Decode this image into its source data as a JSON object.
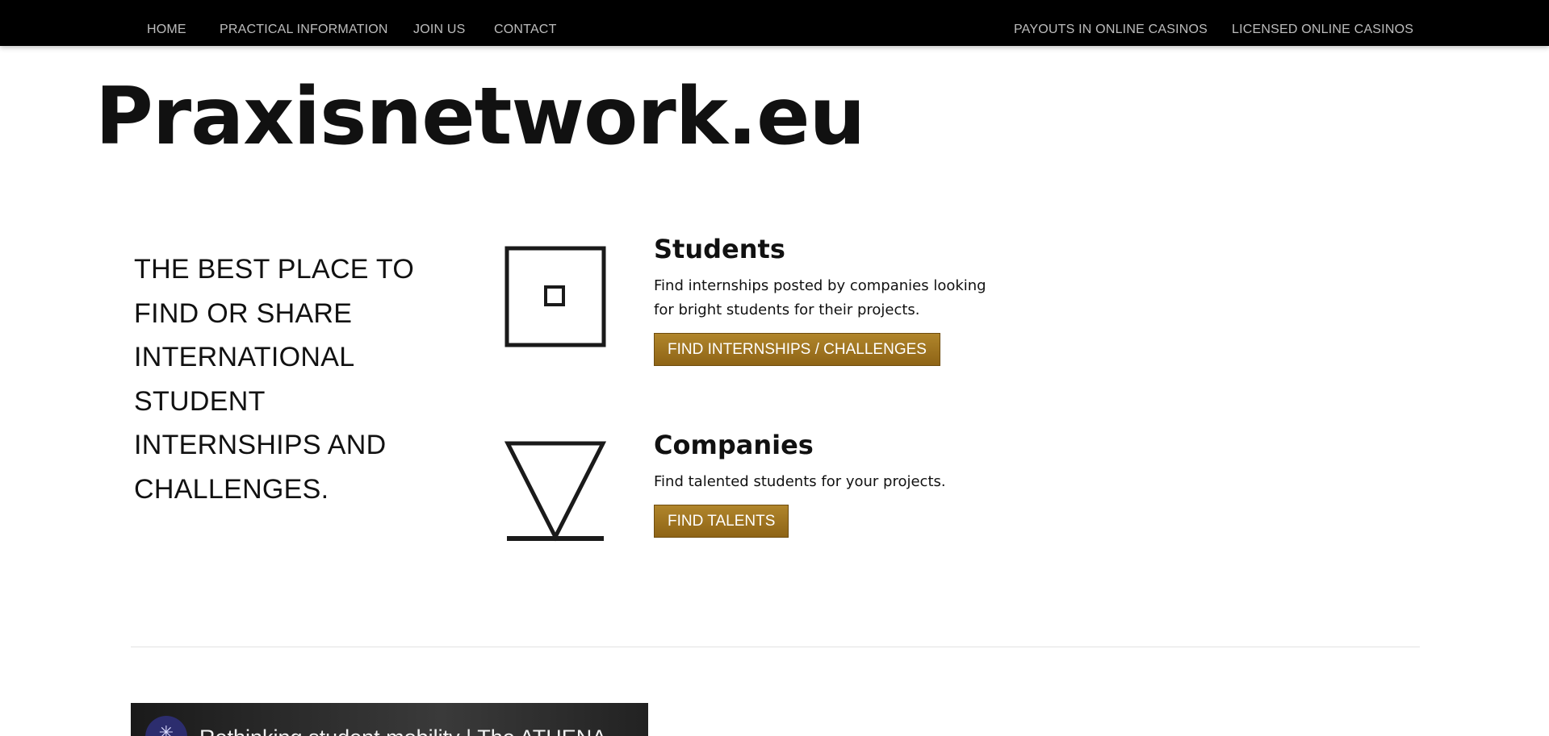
{
  "nav": {
    "left": [
      "HOME",
      "PRACTICAL INFORMATION",
      "JOIN US",
      "CONTACT"
    ],
    "right": [
      "PAYOUTS IN ONLINE CASINOS",
      "LICENSED ONLINE CASINOS"
    ]
  },
  "site_title": "Praxisnetwork.eu",
  "tagline": "THE BEST PLACE TO FIND OR SHARE INTERNATIONAL STUDENT INTERNSHIPS AND CHALLENGES.",
  "students": {
    "icon": "square-in-square-icon",
    "title": "Students",
    "desc": "Find internships posted by companies looking for bright students for their projects.",
    "button": "FIND INTERNSHIPS / CHALLENGES"
  },
  "companies": {
    "icon": "funnel-triangle-icon",
    "title": "Companies",
    "desc": "Find talented students for your projects.",
    "button": "FIND TALENTS"
  },
  "video": {
    "title": "Rethinking student mobility | The ATHENA",
    "channel_icon": "sparkle-icon"
  },
  "colors": {
    "nav_bg": "#000000",
    "nav_text": "#bdbdbd",
    "button_gold": "#a07824",
    "text": "#111111"
  }
}
